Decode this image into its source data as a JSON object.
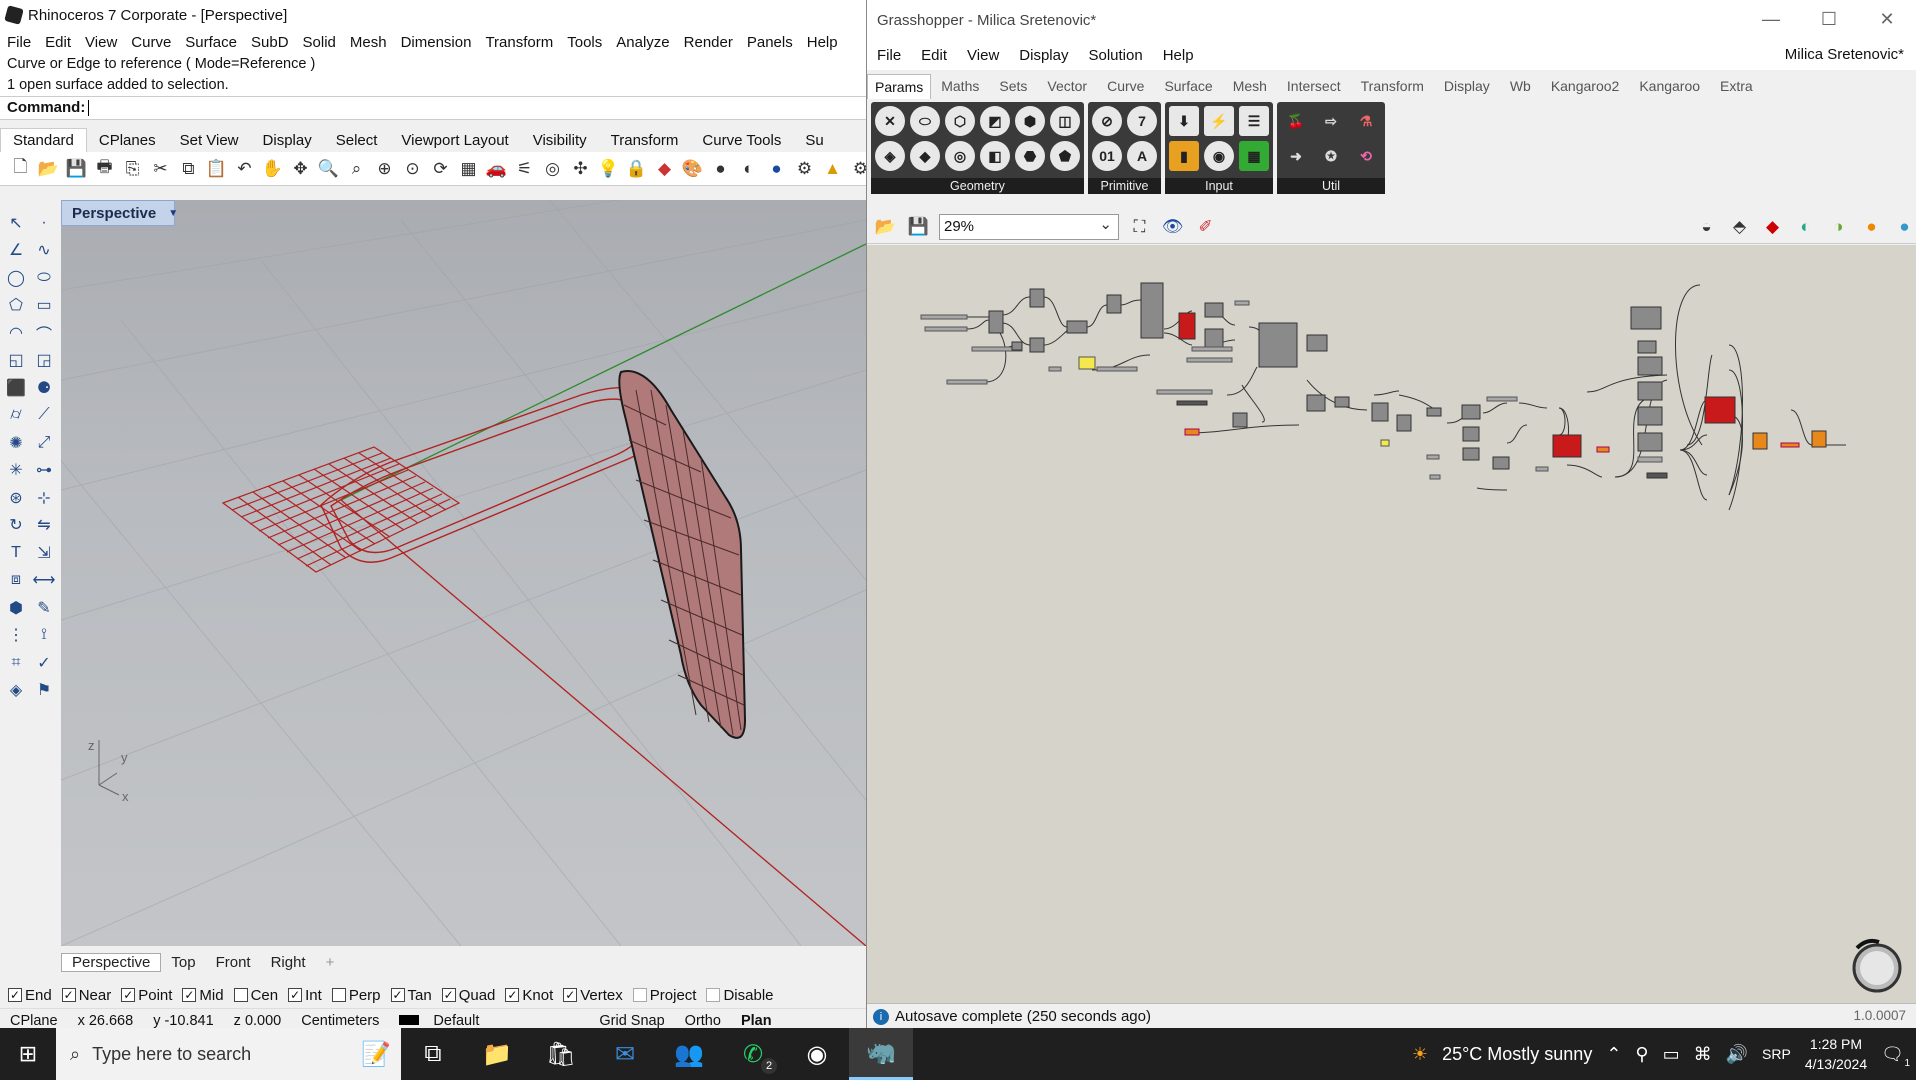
{
  "rhino": {
    "title": "Rhinoceros 7 Corporate - [Perspective]",
    "menu": [
      "File",
      "Edit",
      "View",
      "Curve",
      "Surface",
      "SubD",
      "Solid",
      "Mesh",
      "Dimension",
      "Transform",
      "Tools",
      "Analyze",
      "Render",
      "Panels",
      "Help"
    ],
    "history": [
      "Curve or Edge to reference ( Mode=Reference )",
      "1 open surface added to selection."
    ],
    "command_label": "Command:",
    "tabs": [
      "Standard",
      "CPlanes",
      "Set View",
      "Display",
      "Select",
      "Viewport Layout",
      "Visibility",
      "Transform",
      "Curve Tools",
      "Su"
    ],
    "toolbar_icons": [
      "new-icon",
      "open-icon",
      "save-icon",
      "print-icon",
      "import-icon",
      "copy-icon",
      "paste-icon",
      "undo-icon",
      "pan-icon",
      "move-icon",
      "zoom-icon",
      "zoom-window-icon",
      "zoom-extents-icon",
      "zoom-selected-icon",
      "rotate-view-icon",
      "grid-icon",
      "car-icon",
      "light-icon",
      "target-icon",
      "snap-icon",
      "bulb-icon",
      "lock-icon",
      "material-icon",
      "color-icon",
      "sphere-icon",
      "shaded-icon",
      "render-icon",
      "rhino-icon",
      "gear-icon"
    ],
    "viewport": {
      "label": "Perspective"
    },
    "viewport_tabs": [
      "Perspective",
      "Top",
      "Front",
      "Right",
      "+"
    ],
    "osnaps": [
      {
        "label": "End",
        "checked": true
      },
      {
        "label": "Near",
        "checked": true
      },
      {
        "label": "Point",
        "checked": true
      },
      {
        "label": "Mid",
        "checked": true
      },
      {
        "label": "Cen",
        "checked": false
      },
      {
        "label": "Int",
        "checked": true
      },
      {
        "label": "Perp",
        "checked": false
      },
      {
        "label": "Tan",
        "checked": true
      },
      {
        "label": "Quad",
        "checked": true
      },
      {
        "label": "Knot",
        "checked": true
      },
      {
        "label": "Vertex",
        "checked": true
      },
      {
        "label": "Project",
        "checked": false
      },
      {
        "label": "Disable",
        "checked": false
      }
    ],
    "status": {
      "cplane": "CPlane",
      "x": "x 26.668",
      "y": "y -10.841",
      "z": "z 0.000",
      "units": "Centimeters",
      "layer": "Default",
      "grid_snap": "Grid Snap",
      "ortho": "Ortho",
      "planar": "Plan"
    }
  },
  "gh": {
    "title": "Grasshopper - Milica Sretenovic*",
    "menu": [
      "File",
      "Edit",
      "View",
      "Display",
      "Solution",
      "Help"
    ],
    "user": "Milica Sretenovic*",
    "tabs": [
      "Params",
      "Maths",
      "Sets",
      "Vector",
      "Curve",
      "Surface",
      "Mesh",
      "Intersect",
      "Transform",
      "Display",
      "Wb",
      "Kangaroo2",
      "Kangaroo",
      "Extra"
    ],
    "groups": [
      {
        "label": "Geometry",
        "icons": [
          "✕",
          "◈",
          "⬭",
          "◆",
          "⬡",
          "◎",
          "◩",
          "◧",
          "⬢",
          "⬣",
          "◫",
          "⬟"
        ]
      },
      {
        "label": "Primitive",
        "icons": [
          "⊘",
          "01",
          "7",
          "A"
        ]
      },
      {
        "label": "Input",
        "icons": [
          "⬇",
          "▮",
          "⚡",
          "◉",
          "☰",
          "▦"
        ]
      },
      {
        "label": "Util",
        "icons": [
          "🍒",
          "➜",
          "⇨",
          "✪",
          "⚗",
          "⟲"
        ]
      }
    ],
    "zoom": "29%",
    "status": "Autosave complete (250 seconds ago)",
    "version": "1.0.0007"
  },
  "taskbar": {
    "search_placeholder": "Type here to search",
    "weather": "25°C  Mostly sunny",
    "lang": "SRP",
    "time": "1:28 PM",
    "date": "4/13/2024",
    "whatsapp_badge": "2",
    "notif_badge": "1"
  }
}
